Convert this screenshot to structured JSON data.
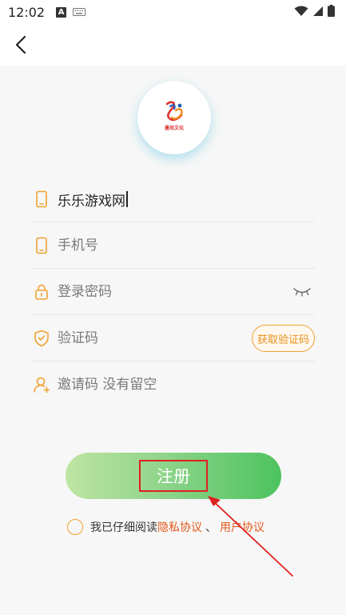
{
  "status_bar": {
    "time": "12:02",
    "notification_badge": "A"
  },
  "header": {
    "back_icon": "chevron-left-icon"
  },
  "logo": {
    "brand_text": "墨尚文化"
  },
  "form": {
    "username": {
      "value": "乐乐游戏网",
      "icon": "phone-icon"
    },
    "phone": {
      "placeholder": "手机号",
      "icon": "phone-icon"
    },
    "password": {
      "placeholder": "登录密码",
      "icon": "lock-icon",
      "toggle_icon": "eye-closed-icon"
    },
    "verify_code": {
      "placeholder": "验证码",
      "icon": "shield-check-icon",
      "button_label": "获取验证码"
    },
    "invite_code": {
      "placeholder": "邀请码 没有留空",
      "icon": "user-add-icon"
    }
  },
  "register_button": {
    "label": "注册"
  },
  "agreement": {
    "prefix": "我已仔细阅读",
    "privacy_link": "隐私协议",
    "separator": "、",
    "user_link": "用户协议"
  },
  "colors": {
    "accent_orange": "#f0a030",
    "link_orange": "#e25a1c",
    "button_gradient_start": "#bfe4a2",
    "button_gradient_end": "#4cc35e",
    "annotation_red": "#e02020"
  }
}
